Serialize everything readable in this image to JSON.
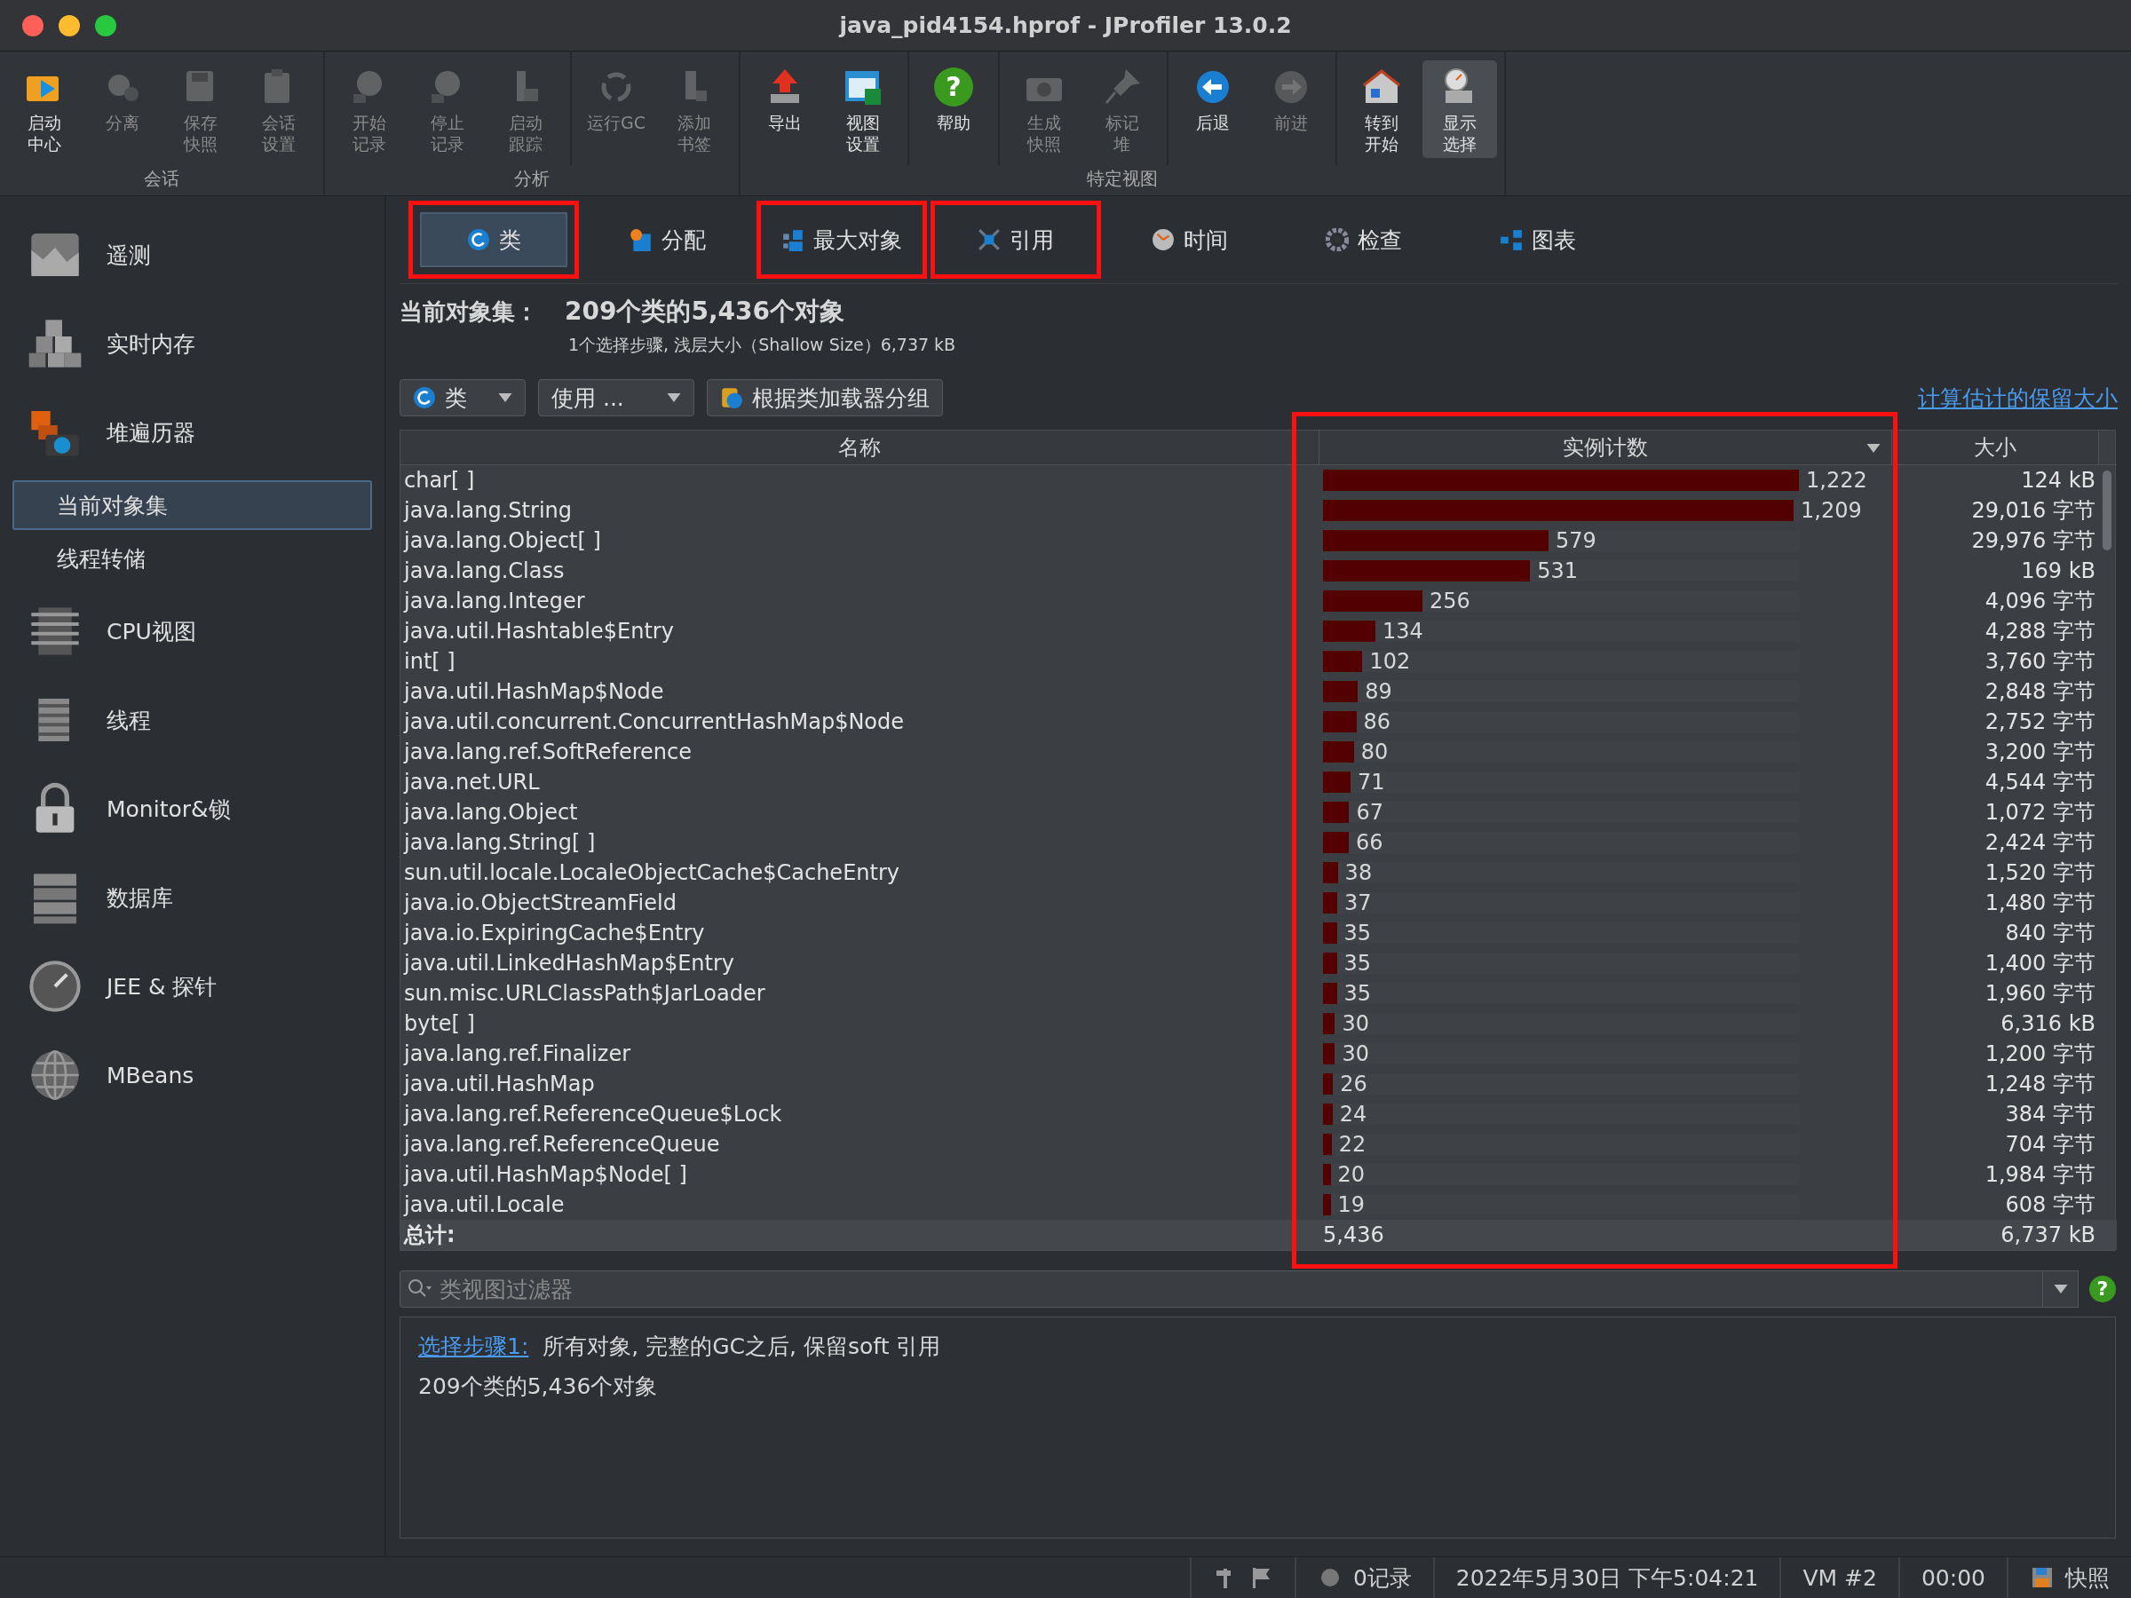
{
  "window": {
    "title": "java_pid4154.hprof - JProfiler 13.0.2"
  },
  "toolbar": {
    "groups": [
      {
        "label": "会话",
        "sections": [
          [
            {
              "kind": "two_line",
              "label": "启动中心",
              "disabled": false,
              "selected": false
            },
            {
              "kind": "one_line",
              "label": "分离",
              "disabled": true,
              "selected": false
            },
            {
              "kind": "two_line",
              "label": "保存快照",
              "disabled": true,
              "selected": false
            },
            {
              "kind": "two_line",
              "label": "会话设置",
              "disabled": true,
              "selected": false
            }
          ]
        ]
      },
      {
        "label": "分析",
        "sections": [
          [
            {
              "kind": "two_line",
              "label": "开始记录",
              "disabled": true,
              "selected": false
            },
            {
              "kind": "two_line",
              "label": "停止记录",
              "disabled": true,
              "selected": false
            },
            {
              "kind": "two_line",
              "label": "启动跟踪",
              "disabled": true,
              "selected": false
            }
          ],
          [
            {
              "kind": "one_line",
              "label": "运行GC",
              "disabled": true,
              "selected": false
            },
            {
              "kind": "two_line",
              "label": "添加书签",
              "disabled": true,
              "selected": false
            }
          ]
        ]
      },
      {
        "label": "特定视图",
        "sections": [
          [
            {
              "kind": "one_line",
              "label": "导出",
              "disabled": false,
              "selected": false
            },
            {
              "kind": "two_line",
              "label": "视图设置",
              "disabled": false,
              "selected": false
            }
          ],
          [
            {
              "kind": "one_line",
              "label": "帮助",
              "glyph": "?",
              "disabled": false,
              "selected": false
            }
          ],
          [
            {
              "kind": "two_line",
              "label": "生成快照",
              "disabled": true,
              "selected": false
            },
            {
              "kind": "two_line",
              "label": "标记堆",
              "disabled": true,
              "selected": false
            }
          ],
          [
            {
              "kind": "one_line",
              "label": "后退",
              "disabled": false,
              "selected": false
            },
            {
              "kind": "one_line",
              "label": "前进",
              "disabled": true,
              "selected": false
            }
          ],
          [
            {
              "kind": "two_line",
              "label": "转到开始",
              "disabled": false,
              "selected": false
            },
            {
              "kind": "two_line",
              "label": "显示选择",
              "disabled": false,
              "selected": true
            }
          ]
        ]
      }
    ]
  },
  "sidebar": {
    "items": [
      {
        "label": "遥测",
        "selected": false
      },
      {
        "label": "实时内存",
        "selected": false
      },
      {
        "label": "堆遍历器",
        "selected": false,
        "children": [
          {
            "label": "当前对象集",
            "selected": true
          },
          {
            "label": "线程转储",
            "selected": false
          }
        ]
      },
      {
        "label": "CPU视图",
        "selected": false
      },
      {
        "label": "线程",
        "selected": false
      },
      {
        "label": "Monitor&锁",
        "selected": false
      },
      {
        "label": "数据库",
        "selected": false
      },
      {
        "label": "JEE & 探针",
        "selected": false
      },
      {
        "label": "MBeans",
        "selected": false
      }
    ]
  },
  "tabs": [
    {
      "label": "类",
      "selected": true,
      "marked": true
    },
    {
      "label": "分配",
      "selected": false,
      "marked": false
    },
    {
      "label": "最大对象",
      "selected": false,
      "marked": true
    },
    {
      "label": "引用",
      "selected": false,
      "marked": true
    },
    {
      "label": "时间",
      "selected": false,
      "marked": false
    },
    {
      "label": "检查",
      "selected": false,
      "marked": false
    },
    {
      "label": "图表",
      "selected": false,
      "marked": false
    }
  ],
  "header": {
    "label": "当前对象集：",
    "value": "209个类的5,436个对象",
    "detail": "1个选择步骤, 浅层大小（Shallow Size）6,737 kB"
  },
  "controls": {
    "class_dropdown": "类",
    "usage_dropdown": "使用 ...",
    "group_button": "根据类加载器分组",
    "retained_link": "计算估计的保留大小"
  },
  "table": {
    "columns": [
      {
        "label": "名称"
      },
      {
        "label": "实例计数",
        "marked": true
      },
      {
        "label": "大小"
      }
    ],
    "rows": [
      {
        "name": "char[ ]",
        "count": "1,222",
        "level": 1,
        "size": "124 kB"
      },
      {
        "name": "java.lang.String",
        "count": "1,209",
        "level": 0.989,
        "size": "29,016 字节"
      },
      {
        "name": "java.lang.Object[ ]",
        "count": "579",
        "level": 0.474,
        "size": "29,976 字节"
      },
      {
        "name": "java.lang.Class",
        "count": "531",
        "level": 0.435,
        "size": "169 kB"
      },
      {
        "name": "java.lang.Integer",
        "count": "256",
        "level": 0.209,
        "size": "4,096 字节"
      },
      {
        "name": "java.util.Hashtable$Entry",
        "count": "134",
        "level": 0.11,
        "size": "4,288 字节"
      },
      {
        "name": "int[ ]",
        "count": "102",
        "level": 0.083,
        "size": "3,760 字节"
      },
      {
        "name": "java.util.HashMap$Node",
        "count": "89",
        "level": 0.073,
        "size": "2,848 字节"
      },
      {
        "name": "java.util.concurrent.ConcurrentHashMap$Node",
        "count": "86",
        "level": 0.07,
        "size": "2,752 字节"
      },
      {
        "name": "java.lang.ref.SoftReference",
        "count": "80",
        "level": 0.065,
        "size": "3,200 字节"
      },
      {
        "name": "java.net.URL",
        "count": "71",
        "level": 0.058,
        "size": "4,544 字节"
      },
      {
        "name": "java.lang.Object",
        "count": "67",
        "level": 0.055,
        "size": "1,072 字节"
      },
      {
        "name": "java.lang.String[ ]",
        "count": "66",
        "level": 0.054,
        "size": "2,424 字节"
      },
      {
        "name": "sun.util.locale.LocaleObjectCache$CacheEntry",
        "count": "38",
        "level": 0.031,
        "size": "1,520 字节"
      },
      {
        "name": "java.io.ObjectStreamField",
        "count": "37",
        "level": 0.03,
        "size": "1,480 字节"
      },
      {
        "name": "java.io.ExpiringCache$Entry",
        "count": "35",
        "level": 0.029,
        "size": "840 字节"
      },
      {
        "name": "java.util.LinkedHashMap$Entry",
        "count": "35",
        "level": 0.029,
        "size": "1,400 字节"
      },
      {
        "name": "sun.misc.URLClassPath$JarLoader",
        "count": "35",
        "level": 0.029,
        "size": "1,960 字节"
      },
      {
        "name": "byte[ ]",
        "count": "30",
        "level": 0.025,
        "size": "6,316 kB"
      },
      {
        "name": "java.lang.ref.Finalizer",
        "count": "30",
        "level": 0.025,
        "size": "1,200 字节"
      },
      {
        "name": "java.util.HashMap",
        "count": "26",
        "level": 0.021,
        "size": "1,248 字节"
      },
      {
        "name": "java.lang.ref.ReferenceQueue$Lock",
        "count": "24",
        "level": 0.02,
        "size": "384 字节"
      },
      {
        "name": "java.lang.ref.ReferenceQueue",
        "count": "22",
        "level": 0.018,
        "size": "704 字节"
      },
      {
        "name": "java.util.HashMap$Node[ ]",
        "count": "20",
        "level": 0.016,
        "size": "1,984 字节"
      },
      {
        "name": "java.util.Locale",
        "count": "19",
        "level": 0.016,
        "size": "608 字节"
      }
    ],
    "total": {
      "label": "总计:",
      "count": "5,436",
      "size": "6,737 kB"
    }
  },
  "filter": {
    "placeholder": "类视图过滤器",
    "help_glyph": "?"
  },
  "info": {
    "step_link": "选择步骤1:",
    "step_text": "所有对象, 完整的GC之后, 保留soft 引用",
    "summary": "209个类的5,436个对象"
  },
  "status_bar": {
    "records": "0记录",
    "datetime": "2022年5月30日 下午5:04:21",
    "vm": "VM #2",
    "time": "00:00",
    "snapshot": "快照"
  }
}
